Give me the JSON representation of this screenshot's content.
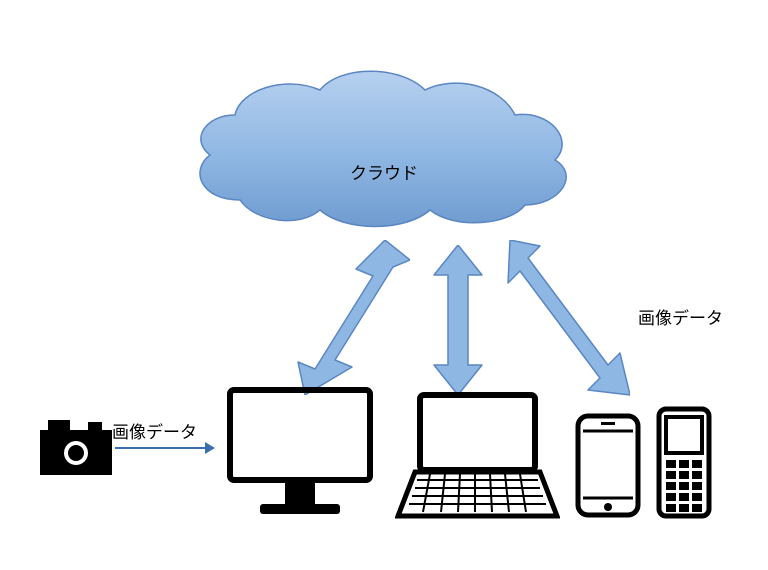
{
  "diagram": {
    "cloud_label": "クラウド",
    "image_data_label_left": "画像データ",
    "image_data_label_right": "画像データ",
    "nodes": {
      "cloud": "cloud",
      "camera": "camera",
      "desktop": "desktop-monitor",
      "laptop": "laptop",
      "smartphone": "smartphone",
      "feature_phone": "feature-phone"
    },
    "arrows": [
      {
        "from": "cloud",
        "to": "desktop",
        "type": "bidirectional"
      },
      {
        "from": "cloud",
        "to": "laptop",
        "type": "bidirectional"
      },
      {
        "from": "cloud",
        "to": "smartphone",
        "type": "bidirectional"
      },
      {
        "from": "camera",
        "to": "desktop",
        "type": "unidirectional"
      }
    ],
    "colors": {
      "cloud_fill": "#8fb7e3",
      "cloud_shade": "#6f9bd0",
      "arrow": "#8fb7e3",
      "arrow_stroke": "#5a86c2",
      "thin_arrow": "#3a6fae",
      "device_stroke": "#000000"
    }
  }
}
